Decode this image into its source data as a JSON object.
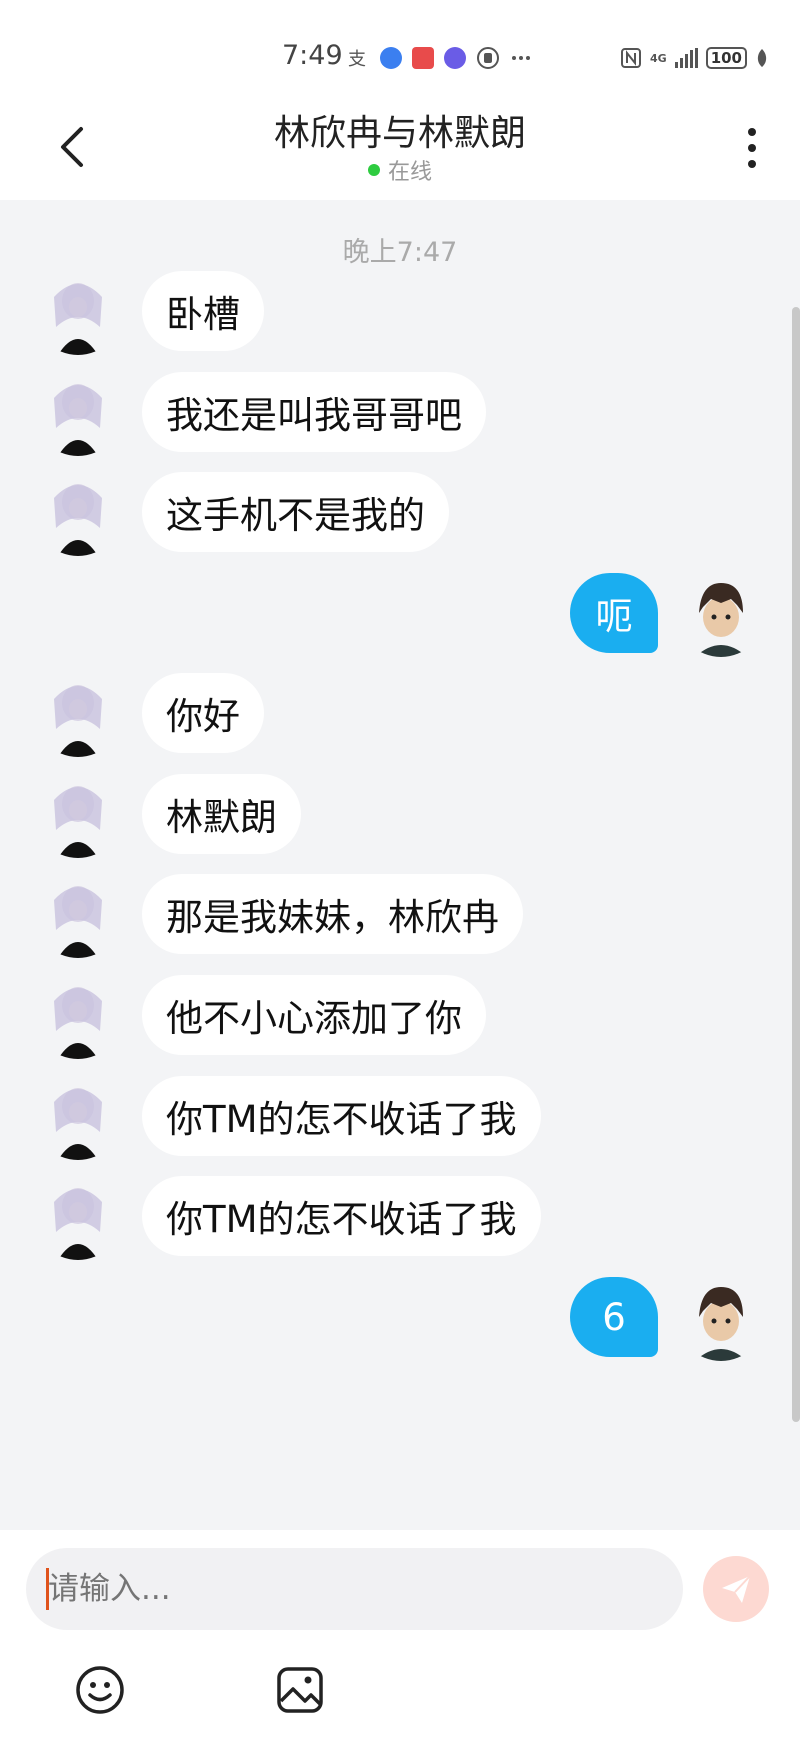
{
  "status_bar": {
    "time": "7:49",
    "network": "4G",
    "battery": "100"
  },
  "header": {
    "title": "林欣冉与林默朗",
    "status": "在线"
  },
  "chat": {
    "timestamp": "晚上7:47",
    "messages": [
      {
        "side": "left",
        "text": "卧槽"
      },
      {
        "side": "left",
        "text": "我还是叫我哥哥吧"
      },
      {
        "side": "left",
        "text": "这手机不是我的"
      },
      {
        "side": "right",
        "text": "呃"
      },
      {
        "side": "left",
        "text": "你好"
      },
      {
        "side": "left",
        "text": "林默朗"
      },
      {
        "side": "left",
        "text": "那是我妹妹，林欣冉"
      },
      {
        "side": "left",
        "text": "他不小心添加了你"
      },
      {
        "side": "left",
        "text": "你TM的怎不收话了我"
      },
      {
        "side": "left",
        "text": "你TM的怎不收话了我"
      },
      {
        "side": "right",
        "text": "6"
      }
    ]
  },
  "composer": {
    "placeholder": "请输入..."
  },
  "colors": {
    "sent_bubble": "#1aaef0",
    "received_bubble": "#ffffff",
    "chat_background": "#f3f4f6",
    "online": "#2ecc40",
    "send_button": "#fdd9d2"
  },
  "icons": [
    "back-icon",
    "more-icon",
    "send-icon",
    "emoji-icon",
    "image-icon"
  ]
}
